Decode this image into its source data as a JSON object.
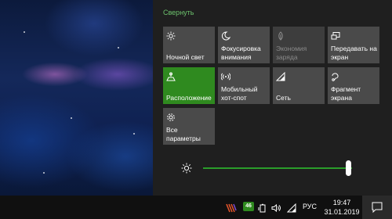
{
  "action_center": {
    "collapse_label": "Свернуть",
    "tiles": [
      {
        "label": "Ночной свет",
        "icon": "night-light-icon",
        "state": "off"
      },
      {
        "label": "Фокусировка внимания",
        "icon": "focus-assist-icon",
        "state": "off"
      },
      {
        "label": "Экономия заряда",
        "icon": "battery-saver-icon",
        "state": "disabled"
      },
      {
        "label": "Передавать на экран",
        "icon": "project-icon",
        "state": "off"
      },
      {
        "label": "Расположение",
        "icon": "location-icon",
        "state": "on"
      },
      {
        "label": "Мобильный хот-спот",
        "icon": "hotspot-icon",
        "state": "off"
      },
      {
        "label": "Сеть",
        "icon": "network-icon",
        "state": "off"
      },
      {
        "label": "Фрагмент экрана",
        "icon": "screen-snip-icon",
        "state": "off"
      },
      {
        "label": "Все параметры",
        "icon": "settings-gear-icon",
        "state": "off"
      }
    ],
    "brightness": {
      "icon": "brightness-icon",
      "level": 1.0
    }
  },
  "taskbar": {
    "network_badge": "46",
    "language": "РУС",
    "time": "19:47",
    "date": "31.01.2019"
  },
  "colors": {
    "accent": "#2f8a1f",
    "tile": "#4a4a4a",
    "panel": "#1f1f1f",
    "collapse_link": "#6dc26d"
  }
}
